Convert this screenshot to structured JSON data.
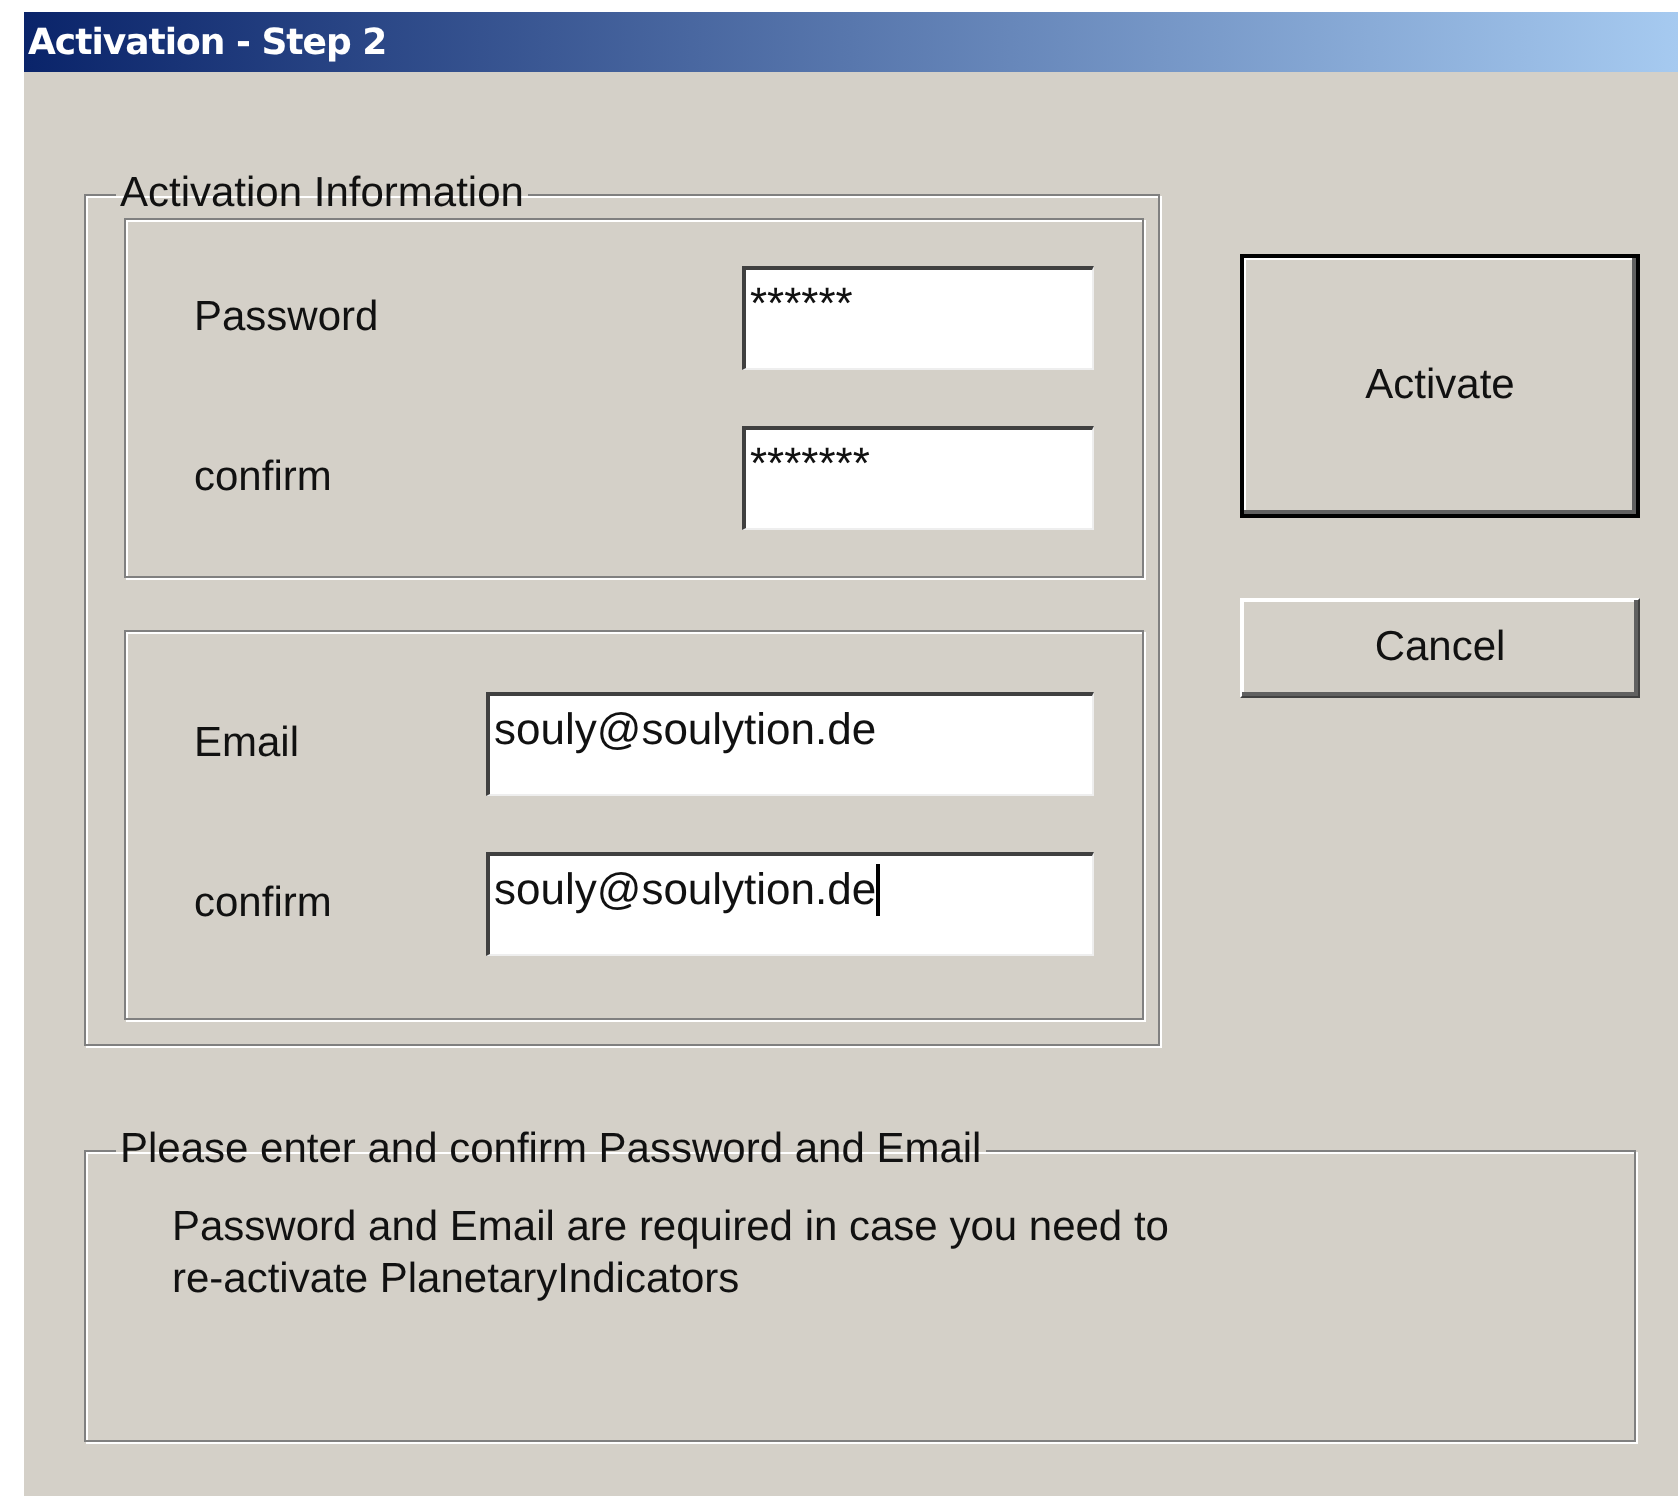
{
  "window": {
    "title": "Activation - Step 2"
  },
  "activation_information": {
    "legend": "Activation Information",
    "password_group": [
      {
        "label": "Password",
        "value": "******",
        "focused": false
      },
      {
        "label": "confirm",
        "value": "*******",
        "focused": false
      }
    ],
    "email_group": [
      {
        "label": "Email",
        "value": "souly@soulytion.de",
        "focused": false
      },
      {
        "label": "confirm",
        "value": "souly@soulytion.de",
        "focused": true
      }
    ]
  },
  "buttons": [
    {
      "label": "Activate",
      "default": true
    },
    {
      "label": "Cancel",
      "default": false
    }
  ],
  "hint": {
    "legend": "Please enter and confirm Password and Email",
    "text": "Password and Email are required in case you need to re-activate PlanetaryIndicators"
  }
}
